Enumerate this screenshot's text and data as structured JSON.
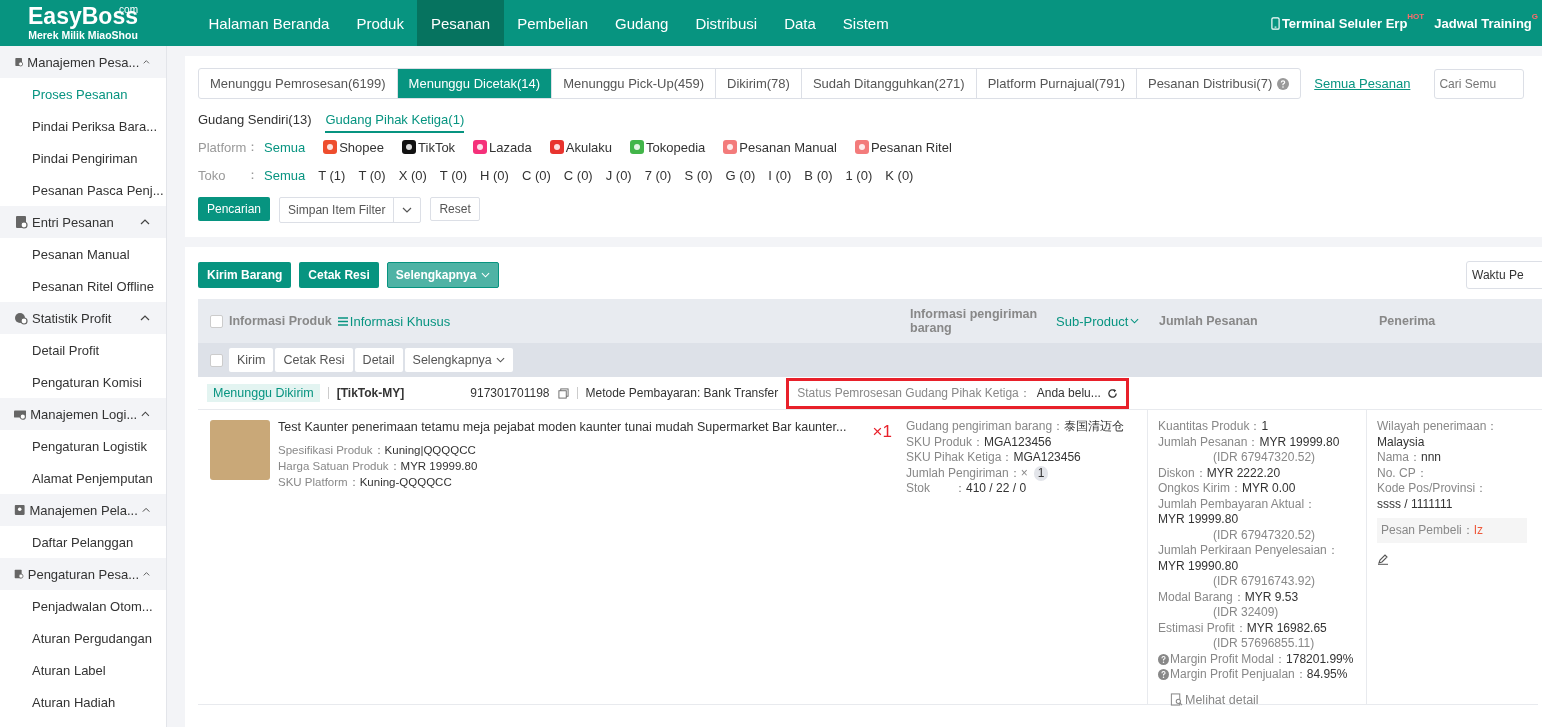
{
  "brand": {
    "name": "EasyBoss",
    "suffix": ".com",
    "tagline": "Merek Milik MiaoShou"
  },
  "nav": [
    {
      "label": "Halaman Beranda",
      "selected": false
    },
    {
      "label": "Produk",
      "selected": false
    },
    {
      "label": "Pesanan",
      "selected": true
    },
    {
      "label": "Pembelian",
      "selected": false
    },
    {
      "label": "Gudang",
      "selected": false
    },
    {
      "label": "Distribusi",
      "selected": false
    },
    {
      "label": "Data",
      "selected": false
    },
    {
      "label": "Sistem",
      "selected": false
    }
  ],
  "nav_right": [
    {
      "kind": "phone",
      "label": "Terminal Seluler Erp",
      "badge": "HOT"
    },
    {
      "kind": "plain",
      "label": "Jadwal Training",
      "badge": "G"
    }
  ],
  "sidebar": [
    {
      "kind": "orders",
      "label": "Manajemen Pesa...",
      "expanded": true,
      "children": [
        {
          "label": "Proses Pesanan",
          "selected": true
        },
        {
          "label": "Pindai Periksa Bara...",
          "selected": false
        },
        {
          "label": "Pindai Pengiriman",
          "selected": false
        },
        {
          "label": "Pesanan Pasca Penj...",
          "selected": false
        }
      ]
    },
    {
      "kind": "entry",
      "label": "Entri Pesanan",
      "expanded": true,
      "children": [
        {
          "label": "Pesanan Manual",
          "selected": false
        },
        {
          "label": "Pesanan Ritel Offline",
          "selected": false
        }
      ]
    },
    {
      "kind": "profit",
      "label": "Statistik Profit",
      "expanded": true,
      "children": [
        {
          "label": "Detail Profit",
          "selected": false
        },
        {
          "label": "Pengaturan Komisi",
          "selected": false
        }
      ]
    },
    {
      "kind": "logistics",
      "label": "Manajemen Logi...",
      "expanded": true,
      "children": [
        {
          "label": "Pengaturan Logistik",
          "selected": false
        },
        {
          "label": "Alamat Penjemputan",
          "selected": false
        }
      ]
    },
    {
      "kind": "customer",
      "label": "Manajemen Pela...",
      "expanded": true,
      "children": [
        {
          "label": "Daftar Pelanggan",
          "selected": false
        }
      ]
    },
    {
      "kind": "settings",
      "label": "Pengaturan Pesa...",
      "expanded": true,
      "children": [
        {
          "label": "Penjadwalan Otom...",
          "selected": false
        },
        {
          "label": "Aturan Pergudangan",
          "selected": false
        },
        {
          "label": "Aturan Label",
          "selected": false
        },
        {
          "label": "Aturan Hadiah",
          "selected": false
        }
      ]
    }
  ],
  "status_tabs": [
    {
      "label": "Menunggu Pemrosesan(6199)",
      "selected": false,
      "help": false
    },
    {
      "label": "Menunggu Dicetak(14)",
      "selected": true,
      "help": false
    },
    {
      "label": "Menunggu Pick-Up(459)",
      "selected": false,
      "help": false
    },
    {
      "label": "Dikirim(78)",
      "selected": false,
      "help": false
    },
    {
      "label": "Sudah Ditangguhkan(271)",
      "selected": false,
      "help": false
    },
    {
      "label": "Platform Purnajual(791)",
      "selected": false,
      "help": false
    },
    {
      "label": "Pesanan Distribusi(7)",
      "selected": false,
      "help": true
    }
  ],
  "all_orders_link": "Semua Pesanan",
  "search": {
    "placeholder": "Cari Semu"
  },
  "warehouse_tabs": [
    {
      "label": "Gudang Sendiri(13)",
      "selected": false
    },
    {
      "label": "Gudang Pihak Ketiga(1)",
      "selected": true
    }
  ],
  "platform_filter": {
    "label": "Platform",
    "colon": "：",
    "options": [
      {
        "kind": "all",
        "label": "Semua",
        "selected": true
      },
      {
        "kind": "shopee",
        "label": "Shopee",
        "selected": false
      },
      {
        "kind": "tiktok",
        "label": "TikTok",
        "selected": false
      },
      {
        "kind": "lazada",
        "label": "Lazada",
        "selected": false
      },
      {
        "kind": "akulaku",
        "label": "Akulaku",
        "selected": false
      },
      {
        "kind": "tokopedia",
        "label": "Tokopedia",
        "selected": false
      },
      {
        "kind": "manual",
        "label": "Pesanan Manual",
        "selected": false
      },
      {
        "kind": "retail",
        "label": "Pesanan Ritel",
        "selected": false
      }
    ]
  },
  "store_filter": {
    "label": "Toko",
    "colon": "：",
    "options": [
      {
        "label": "Semua",
        "selected": true
      },
      {
        "label": "T (1)",
        "selected": false
      },
      {
        "label": "T (0)",
        "selected": false
      },
      {
        "label": "X (0)",
        "selected": false
      },
      {
        "label": "T (0)",
        "selected": false
      },
      {
        "label": "H (0)",
        "selected": false
      },
      {
        "label": "C (0)",
        "selected": false
      },
      {
        "label": "C (0)",
        "selected": false
      },
      {
        "label": "J (0)",
        "selected": false
      },
      {
        "label": "7 (0)",
        "selected": false
      },
      {
        "label": "S (0)",
        "selected": false
      },
      {
        "label": "G (0)",
        "selected": false
      },
      {
        "label": "I (0)",
        "selected": false
      },
      {
        "label": "B (0)",
        "selected": false
      },
      {
        "label": "1 (0)",
        "selected": false
      },
      {
        "label": "K (0)",
        "selected": false
      }
    ]
  },
  "filter_buttons": {
    "search": "Pencarian",
    "save": "Simpan Item Filter",
    "reset": "Reset"
  },
  "actions": [
    {
      "label": "Kirim Barang",
      "kind": "primary"
    },
    {
      "label": "Cetak Resi",
      "kind": "primary"
    },
    {
      "label": "Selengkapnya",
      "kind": "dropdown"
    }
  ],
  "time_select": "Waktu Pe",
  "table": {
    "header_checked": false,
    "batch_checked": false,
    "columns": {
      "product": "Informasi Produk",
      "custom": "Informasi Khusus",
      "shipping": "Informasi pengiriman barang",
      "sub_product": "Sub-Product",
      "amount": "Jumlah Pesanan",
      "recipient": "Penerima"
    },
    "batch_actions": [
      {
        "label": "Kirim",
        "dropdown": false
      },
      {
        "label": "Cetak Resi",
        "dropdown": false
      },
      {
        "label": "Detail",
        "dropdown": false
      },
      {
        "label": "Selengkapnya",
        "dropdown": true
      }
    ],
    "order": {
      "status": "Menunggu Dikirim",
      "platform": "[TikTok-MY]",
      "order_no": "917301701198",
      "payment": "Metode Pembayaran: Bank Transfer",
      "wh_status_label": "Status Pemrosesan Gudang Pihak Ketiga：",
      "wh_status_value": "Anda belu...",
      "highlighted": true,
      "product": {
        "title": "Test Kaunter penerimaan tetamu meja pejabat moden kaunter tunai mudah Supermarket Bar kaunter...",
        "quantity": "×1",
        "fields": [
          {
            "label": "Spesifikasi Produk：",
            "value": "Kuning|QQQQCC"
          },
          {
            "label": "Harga Satuan Produk：",
            "value": "MYR 19999.80"
          },
          {
            "label": "SKU Platform：",
            "value": "Kuning-QQQQCC"
          }
        ]
      },
      "shipping": [
        {
          "label": "Gudang pengiriman barang：",
          "value": "泰国清迈仓",
          "count": false
        },
        {
          "label": "SKU Produk：",
          "value": "MGA123456",
          "count": false
        },
        {
          "label": "SKU Pihak Ketiga：",
          "value": "MGA123456",
          "count": false
        },
        {
          "label": "Jumlah Pengiriman：×",
          "value": "1",
          "count": true
        },
        {
          "label": "Stok　　：",
          "value": "410 / 22 / 0",
          "count": false
        }
      ],
      "amount": [
        {
          "kind": "inline",
          "label": "Kuantitas Produk：",
          "value": "1",
          "help": false
        },
        {
          "kind": "inline",
          "label": "Jumlah Pesanan：",
          "value": "MYR 19999.80",
          "sub": "(IDR 67947320.52)",
          "help": false
        },
        {
          "kind": "inline",
          "label": "Diskon：",
          "value": "MYR 2222.20",
          "help": false
        },
        {
          "kind": "inline",
          "label": "Ongkos Kirim：",
          "value": "MYR 0.00",
          "help": false
        },
        {
          "kind": "block",
          "label": "Jumlah Pembayaran Aktual：",
          "value": "MYR 19999.80",
          "sub": "(IDR 67947320.52)",
          "help": false
        },
        {
          "kind": "block",
          "label": "Jumlah Perkiraan Penyelesaian：",
          "value": "MYR 19990.80",
          "sub": "(IDR 67916743.92)",
          "help": false
        },
        {
          "kind": "inline",
          "label": "Modal Barang：",
          "value": "MYR 9.53",
          "sub": "(IDR 32409)",
          "help": false
        },
        {
          "kind": "inline",
          "label": "Estimasi Profit：",
          "value": "MYR 16982.65",
          "sub": "(IDR 57696855.11)",
          "help": false
        },
        {
          "kind": "inline",
          "label": "Margin Profit Modal：",
          "value": "178201.99%",
          "help": true
        },
        {
          "kind": "inline",
          "label": "Margin Profit Penjualan：",
          "value": "84.95%",
          "help": true
        }
      ],
      "detail_link": "Melihat detail",
      "recipient": [
        {
          "kind": "block",
          "label": "Wilayah penerimaan：",
          "value": "Malaysia"
        },
        {
          "kind": "inline",
          "label": "Nama：",
          "value": "nnn"
        },
        {
          "kind": "inline",
          "label": "No. CP："
        },
        {
          "kind": "block",
          "label": "Kode Pos/Provinsi：",
          "value": "ssss / 1111111"
        }
      ],
      "buyer_note": {
        "label": "Pesan Pembeli：",
        "value": "Iz"
      }
    }
  }
}
